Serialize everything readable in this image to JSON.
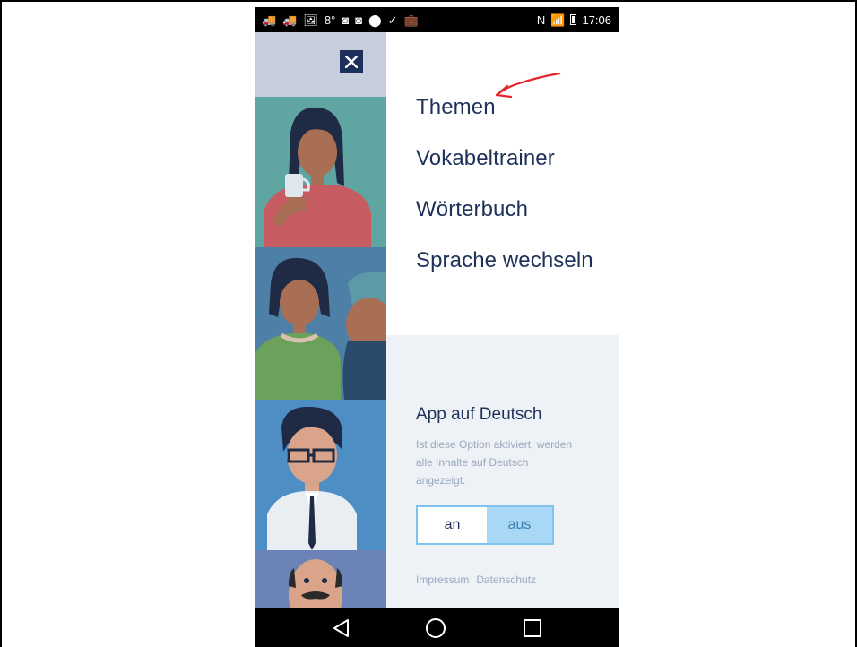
{
  "status_bar": {
    "left_glyphs": [
      "🚚",
      "🚚",
      "🖼",
      "8°",
      "◙",
      "◙",
      "⬤",
      "✓",
      "💼"
    ],
    "right_glyphs": [
      "N",
      "📶"
    ],
    "time": "17:06"
  },
  "menu": {
    "items": [
      {
        "label": "Themen"
      },
      {
        "label": "Vokabeltrainer"
      },
      {
        "label": "Wörterbuch"
      },
      {
        "label": "Sprache wechseln"
      }
    ]
  },
  "option": {
    "title": "App auf Deutsch",
    "description": "Ist diese Option aktiviert, werden alle Inhalte auf Deutsch angezeigt.",
    "toggle_on": "an",
    "toggle_off": "aus"
  },
  "footer": {
    "impressum": "Impressum",
    "datenschutz": "Datenschutz"
  },
  "colors": {
    "navy": "#1d3159",
    "light_blue": "#a8d8f5",
    "panel_bg": "#eef1f5",
    "annotation": "#e3242b"
  },
  "icons": {
    "close": "close-icon",
    "back": "back-triangle-icon",
    "home": "home-circle-icon",
    "recents": "recents-square-icon"
  }
}
